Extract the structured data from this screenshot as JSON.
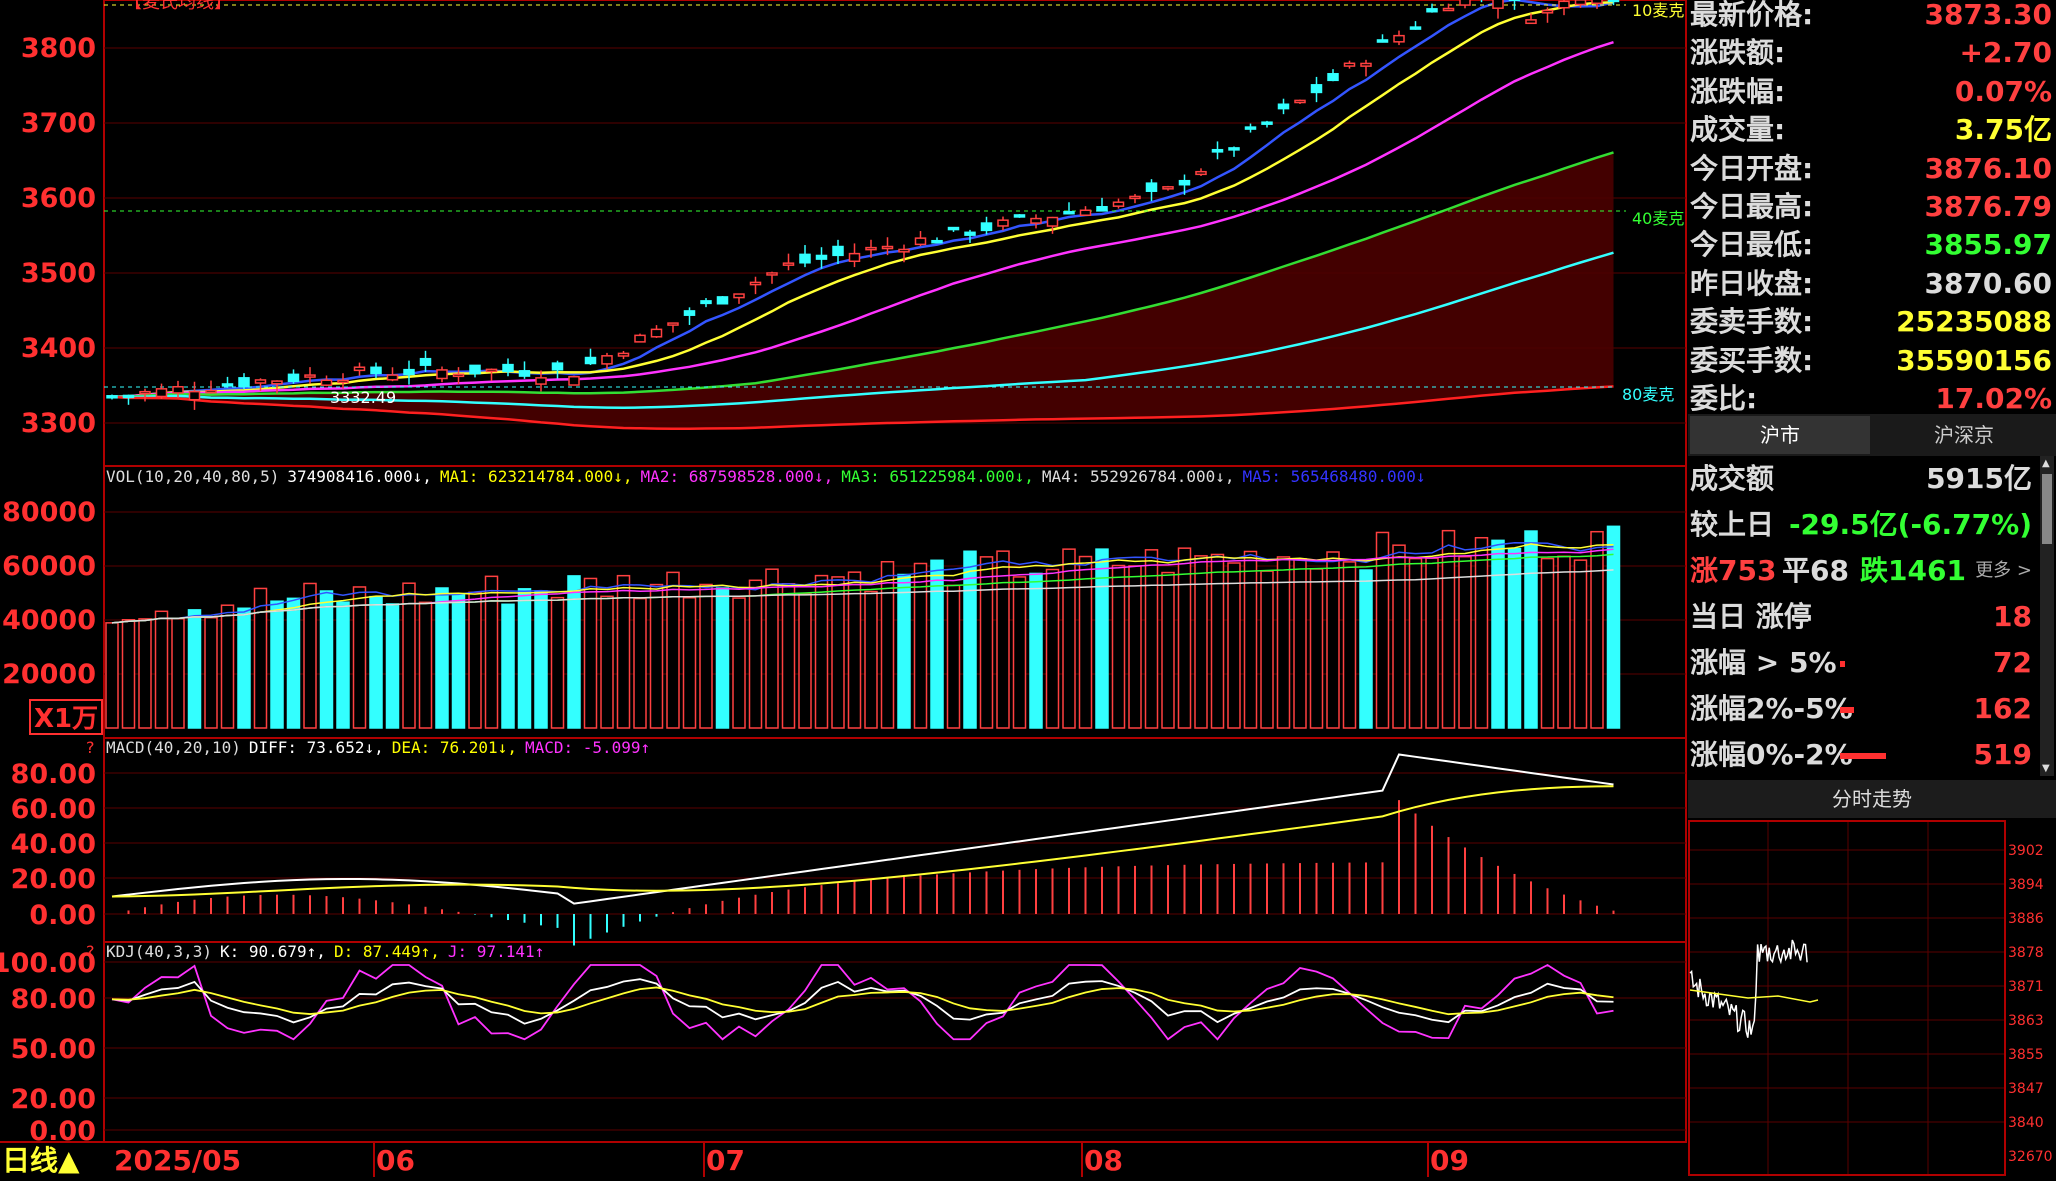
{
  "chart_title": "【麦氏均线】",
  "period_label": "日线▲",
  "months": [
    "2025/05",
    "06",
    "07",
    "08",
    "09"
  ],
  "ma_markers": {
    "m10": "10麦克",
    "m40": "40麦克",
    "m80": "80麦克"
  },
  "low_marker": "3332.49",
  "price_axis": [
    "3800",
    "3700",
    "3600",
    "3500",
    "3400",
    "3300"
  ],
  "vol_axis": [
    "80000",
    "60000",
    "40000",
    "20000"
  ],
  "vol_unit": "X1万",
  "macd_axis": [
    "80.00",
    "60.00",
    "40.00",
    "20.00",
    "0.00"
  ],
  "kdj_axis": [
    "100.00",
    "80.00",
    "50.00",
    "20.00",
    "0.00"
  ],
  "vol_legend": [
    {
      "text": "VOL(10,20,40,80,5)",
      "color": "#dddddd"
    },
    {
      "text": "374908416.000↓,",
      "color": "#ffffff"
    },
    {
      "text": "MA1: 623214784.000↓,",
      "color": "#ffff00"
    },
    {
      "text": "MA2: 687598528.000↓,",
      "color": "#ff33ff"
    },
    {
      "text": "MA3: 651225984.000↓,",
      "color": "#33ff33"
    },
    {
      "text": "MA4: 552926784.000↓,",
      "color": "#dddddd"
    },
    {
      "text": "MA5: 565468480.000↓",
      "color": "#3333ff"
    }
  ],
  "macd_legend": [
    {
      "text": "MACD(40,20,10)",
      "color": "#dddddd"
    },
    {
      "text": "DIFF: 73.652↓,",
      "color": "#ffffff"
    },
    {
      "text": "DEA: 76.201↓,",
      "color": "#ffff00"
    },
    {
      "text": "MACD: -5.099↑",
      "color": "#ff33ff"
    }
  ],
  "kdj_legend": [
    {
      "text": "KDJ(40,3,3)",
      "color": "#dddddd"
    },
    {
      "text": "K: 90.679↑,",
      "color": "#ffffff"
    },
    {
      "text": "D: 87.449↑,",
      "color": "#ffff00"
    },
    {
      "text": "J: 97.141↑",
      "color": "#ff33ff"
    }
  ],
  "quote": [
    {
      "label": "最新价格:",
      "value": "3873.30",
      "color": "#ff4040"
    },
    {
      "label": "涨跌额:",
      "value": "+2.70",
      "color": "#ff4040"
    },
    {
      "label": "涨跌幅:",
      "value": "0.07%",
      "color": "#ff4040"
    },
    {
      "label": "成交量:",
      "value": "3.75亿",
      "color": "#ffff33"
    },
    {
      "label": "今日开盘:",
      "value": "3876.10",
      "color": "#ff4040"
    },
    {
      "label": "今日最高:",
      "value": "3876.79",
      "color": "#ff4040"
    },
    {
      "label": "今日最低:",
      "value": "3855.97",
      "color": "#33ff33"
    },
    {
      "label": "昨日收盘:",
      "value": "3870.60",
      "color": "#dcdcdc"
    },
    {
      "label": "委卖手数:",
      "value": "25235088",
      "color": "#ffff33"
    },
    {
      "label": "委买手数:",
      "value": "35590156",
      "color": "#ffff33"
    },
    {
      "label": "委比:",
      "value": "17.02%",
      "color": "#ff4040"
    }
  ],
  "market_tabs": [
    "沪市",
    "沪深京"
  ],
  "stats": {
    "turnover_label": "成交额",
    "turnover_value": "5915亿",
    "vs_prev_label": "较上日",
    "vs_prev_value": "-29.5亿(-6.77%)",
    "rise_count": "涨753",
    "flat_count": "平68",
    "fall_count": "跌1461",
    "more": "更多 >",
    "limit_label": "当日 涨停",
    "limit_value": "18",
    "gt5_label": "涨幅 > 5%",
    "gt5_value": "72",
    "r25_label": "涨幅2%-5%",
    "r25_value": "162",
    "r02_label": "涨幅0%-2%",
    "r02_value": "519"
  },
  "intraday_title": "分时走势",
  "intraday_axis": [
    "3902",
    "3894",
    "3886",
    "3878",
    "3871",
    "3863",
    "3855",
    "3847",
    "3840",
    "32670"
  ],
  "colors": {
    "up": "#ff4040",
    "down": "#33ffff",
    "frame": "#b00000",
    "grid": "#5a0000"
  }
}
